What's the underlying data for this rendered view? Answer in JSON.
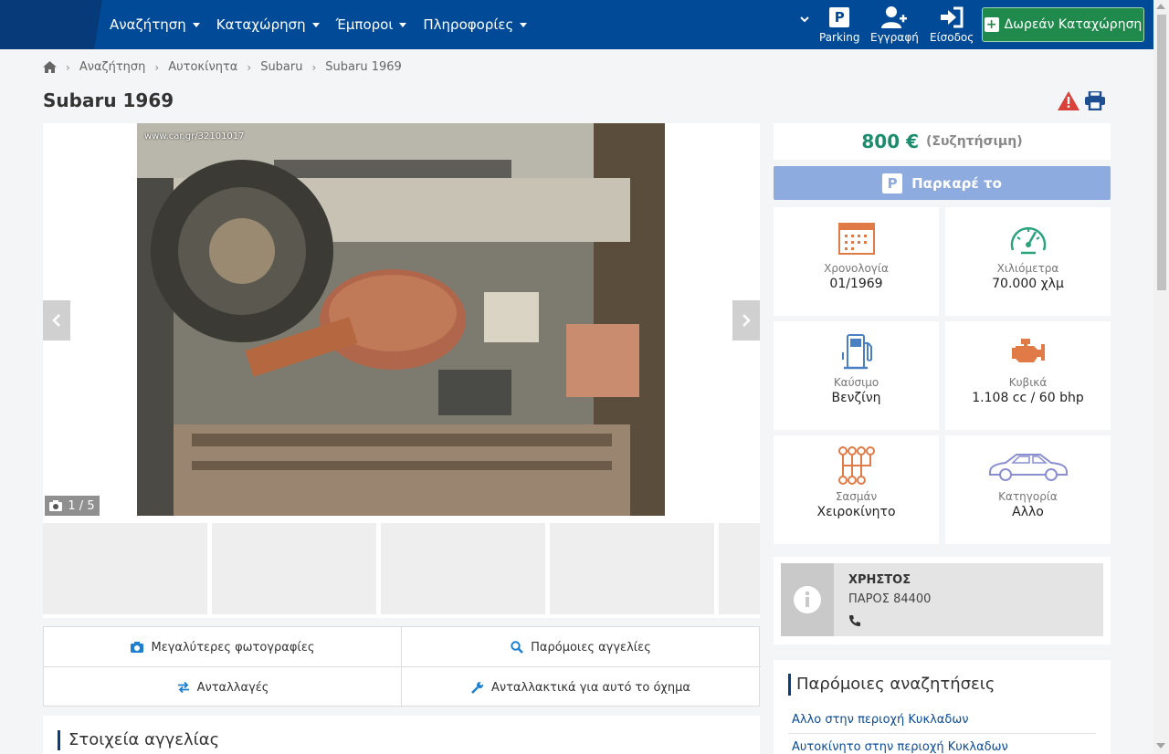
{
  "header": {
    "nav": [
      {
        "label": "Αναζήτηση"
      },
      {
        "label": "Καταχώρηση"
      },
      {
        "label": "Έμποροι"
      },
      {
        "label": "Πληροφορίες"
      }
    ],
    "parking_label": "Parking",
    "register_label": "Εγγραφή",
    "login_label": "Είσοδος",
    "free_listing_label": "Δωρεάν Καταχώρηση",
    "parking_glyph": "P"
  },
  "breadcrumb": [
    "Αναζήτηση",
    "Αυτοκίνητα",
    "Subaru",
    "Subaru 1969"
  ],
  "title": "Subaru 1969",
  "gallery": {
    "watermark": "www.car.gr/32101017",
    "counter": "1 / 5"
  },
  "links": {
    "bigger_photos": "Μεγαλύτερες φωτογραφίες",
    "similar_ads": "Παρόμοιες αγγελίες",
    "exchanges": "Ανταλλαγές",
    "parts": "Ανταλλακτικά για αυτό το όχημα"
  },
  "details_title": "Στοιχεία αγγελίας",
  "price": {
    "value": "800 €",
    "note": "(Συζητήσιμη)"
  },
  "park_button": "Παρκαρέ το",
  "specs": [
    {
      "icon": "calendar-icon",
      "label": "Χρονολογία",
      "value": "01/1969"
    },
    {
      "icon": "speedometer-icon",
      "label": "Χιλιόμετρα",
      "value": "70.000 χλμ"
    },
    {
      "icon": "fuel-pump-icon",
      "label": "Καύσιμο",
      "value": "Βενζίνη"
    },
    {
      "icon": "engine-icon",
      "label": "Κυβικά",
      "value": "1.108 cc / 60 bhp"
    },
    {
      "icon": "gearbox-icon",
      "label": "Σασμάν",
      "value": "Χειροκίνητο"
    },
    {
      "icon": "car-icon",
      "label": "Κατηγορία",
      "value": "Αλλο"
    }
  ],
  "seller": {
    "name": "ΧΡΗΣΤΟΣ",
    "location": "ΠΑΡΟΣ 84400"
  },
  "similar": {
    "title": "Παρόμοιες αναζητήσεις",
    "items": [
      "Αλλο στην περιοχή Κυκλαδων",
      "Αυτοκίνητο στην περιοχή Κυκλαδων"
    ]
  },
  "colors": {
    "header_bg": "#004a97",
    "price": "#1b8d6e",
    "park_button": "#8eabe0",
    "free_button": "#1f8a4c",
    "spec_icon": "#e07b47",
    "accent": "#0b4a95"
  }
}
